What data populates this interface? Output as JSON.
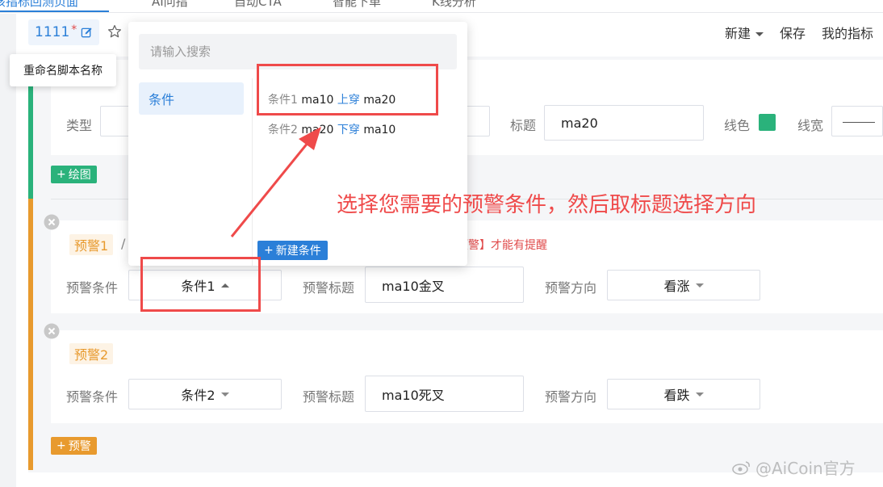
{
  "top_tabs": [
    "该指标回测页面",
    "AI问指",
    "自动CTA",
    "智能下单",
    "K线分析"
  ],
  "header": {
    "script_name": "1111",
    "modified_mark": "*",
    "tooltip": "重命名脚本名称",
    "actions": {
      "new": "新建",
      "save": "保存",
      "my_indicators": "我的指标"
    }
  },
  "plot_section": {
    "type_label": "类型",
    "title_label": "标题",
    "title_value": "ma20",
    "color_label": "线色",
    "color": "#2ab27b",
    "width_label": "线宽",
    "add_plot_button": "绘图"
  },
  "dropdown": {
    "search_placeholder": "请输入搜索",
    "category": "条件",
    "conditions": [
      {
        "num": "条件1",
        "a": "ma10",
        "dir": "上穿",
        "b": "ma20"
      },
      {
        "num": "条件2",
        "a": "ma20",
        "dir": "下穿",
        "b": "ma10"
      }
    ],
    "new_condition_button": "新建条件"
  },
  "warnings": [
    {
      "tag": "预警1",
      "slash": "/",
      "note": "预警】才能有提醒",
      "condition_label": "预警条件",
      "condition_value": "条件1",
      "title_label": "预警标题",
      "title_value": "ma10金叉",
      "direction_label": "预警方向",
      "direction_value": "看涨"
    },
    {
      "tag": "预警2",
      "condition_label": "预警条件",
      "condition_value": "条件2",
      "title_label": "预警标题",
      "title_value": "ma10死叉",
      "direction_label": "预警方向",
      "direction_value": "看跌"
    }
  ],
  "add_warning_button": "预警",
  "annotation": "选择您需要的预警条件，然后取标题选择方向",
  "watermark": "@AiCoin官方",
  "colors": {
    "accent": "#2b7fd8",
    "green": "#2ab27b",
    "orange": "#e89a2e",
    "annotation": "#ef4a4a"
  }
}
